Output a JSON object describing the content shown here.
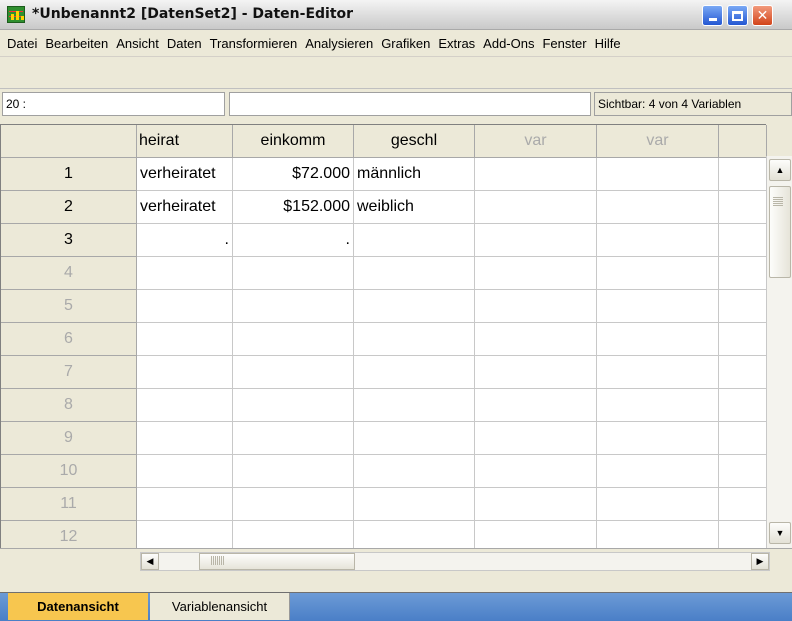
{
  "window": {
    "title": "*Unbenannt2 [DatenSet2] - Daten-Editor",
    "icon": "spss-data-editor-icon"
  },
  "menu": [
    {
      "label": "Datei"
    },
    {
      "label": "Bearbeiten"
    },
    {
      "label": "Ansicht"
    },
    {
      "label": "Daten"
    },
    {
      "label": "Transformieren"
    },
    {
      "label": "Analysieren"
    },
    {
      "label": "Grafiken"
    },
    {
      "label": "Extras"
    },
    {
      "label": "Add-Ons"
    },
    {
      "label": "Fenster"
    },
    {
      "label": "Hilfe"
    }
  ],
  "cellbar": {
    "reference": "20 :",
    "value": "",
    "visible": "Sichtbar: 4 von 4 Variablen"
  },
  "grid": {
    "columns": [
      "heirat",
      "einkomm",
      "geschl",
      "var",
      "var"
    ],
    "rows": [
      {
        "num": "1",
        "cells": [
          "verheiratet",
          "$72.000",
          "männlich",
          "",
          ""
        ]
      },
      {
        "num": "2",
        "cells": [
          "verheiratet",
          "$152.000",
          "weiblich",
          "",
          ""
        ]
      },
      {
        "num": "3",
        "cells": [
          ".",
          ".",
          "",
          "",
          ""
        ]
      },
      {
        "num": "4",
        "cells": [
          "",
          "",
          "",
          "",
          ""
        ]
      },
      {
        "num": "5",
        "cells": [
          "",
          "",
          "",
          "",
          ""
        ]
      },
      {
        "num": "6",
        "cells": [
          "",
          "",
          "",
          "",
          ""
        ]
      },
      {
        "num": "7",
        "cells": [
          "",
          "",
          "",
          "",
          ""
        ]
      },
      {
        "num": "8",
        "cells": [
          "",
          "",
          "",
          "",
          ""
        ]
      },
      {
        "num": "9",
        "cells": [
          "",
          "",
          "",
          "",
          ""
        ]
      },
      {
        "num": "10",
        "cells": [
          "",
          "",
          "",
          "",
          ""
        ]
      },
      {
        "num": "11",
        "cells": [
          "",
          "",
          "",
          "",
          ""
        ]
      },
      {
        "num": "12",
        "cells": [
          "",
          "",
          "",
          "",
          ""
        ]
      }
    ]
  },
  "tabs": {
    "data_view": "Datenansicht",
    "variable_view": "Variablenansicht"
  },
  "colors": {
    "active_tab": "#f7c64f",
    "tab_bar": "#5a8bcf",
    "title_bar": "#dcdcdc"
  }
}
